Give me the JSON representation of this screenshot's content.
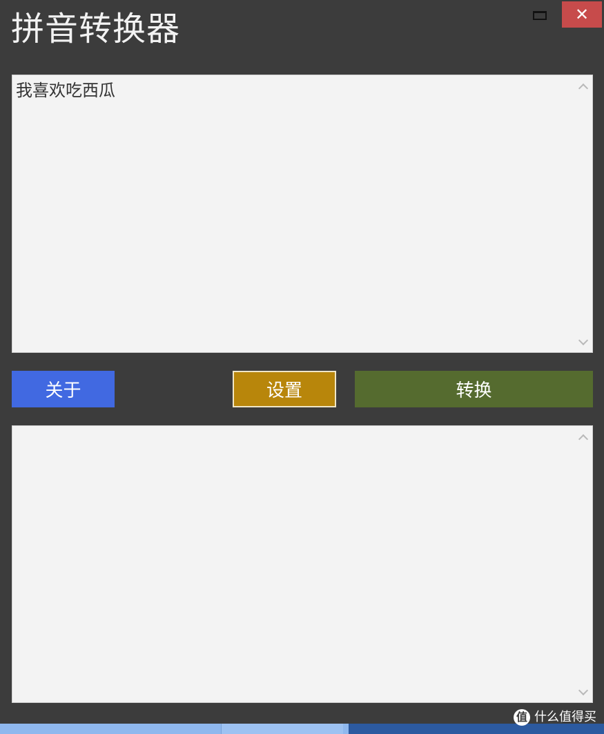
{
  "window": {
    "title": "拼音转换器",
    "close_glyph": "✕"
  },
  "input": {
    "value": "我喜欢吃西瓜"
  },
  "output": {
    "value": ""
  },
  "buttons": {
    "about": "关于",
    "settings": "设置",
    "convert": "转换"
  },
  "watermark": {
    "logo_glyph": "值",
    "text": "什么值得买"
  },
  "colors": {
    "window_bg": "#3c3c3c",
    "about_bg": "#4169e1",
    "settings_bg": "#b8860b",
    "convert_bg": "#556b2f",
    "close_bg": "#c74b4b",
    "textbox_bg": "#f3f3f3"
  },
  "icons": {
    "maximize": "maximize-icon",
    "close": "close-icon",
    "scroll_up": "chevron-up-icon",
    "scroll_down": "chevron-down-icon"
  }
}
